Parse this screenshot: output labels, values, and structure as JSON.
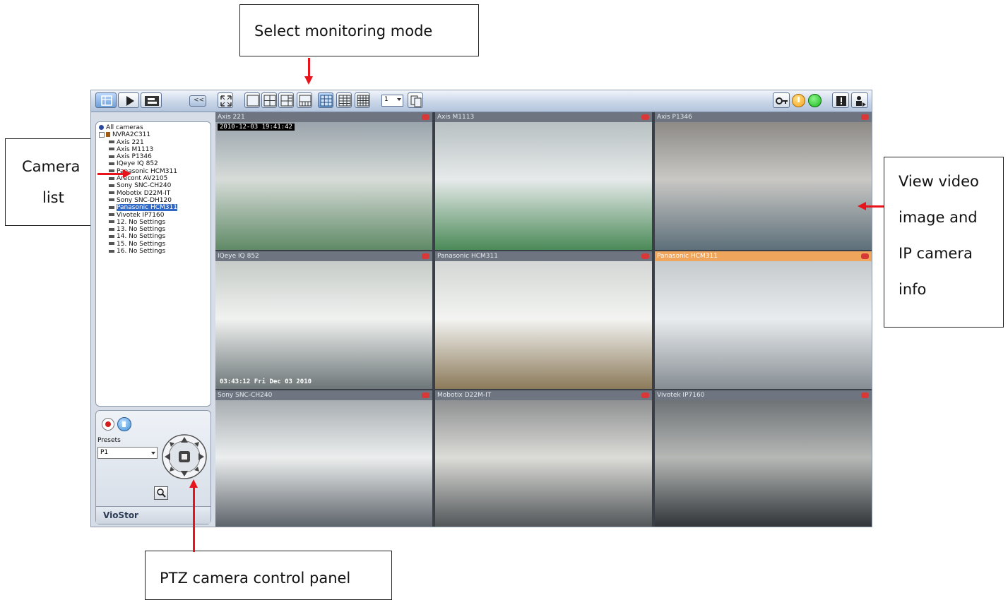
{
  "callouts": {
    "monitoring": "Select monitoring mode",
    "camera_line1": "Camera",
    "camera_line2": "list",
    "view_line1": "View video",
    "view_line2": "image and",
    "view_line3": "IP camera",
    "view_line4": "info",
    "ptz": "PTZ camera control panel"
  },
  "toolbar": {
    "collapse_label": "<<",
    "channel_value": "1"
  },
  "tree": {
    "root": "All cameras",
    "server": "NVRA2C311",
    "cameras": [
      "Axis 221",
      "Axis M1113",
      "Axis P1346",
      "IQeye IQ 852",
      "Panasonic HCM311",
      "Arecont AV2105",
      "Sony SNC-CH240",
      "Mobotix D22M-IT",
      "Sony SNC-DH120",
      "Panasonic HCM311",
      "Vivotek IP7160",
      "12. No Settings",
      "13. No Settings",
      "14. No Settings",
      "15. No Settings",
      "16. No Settings"
    ],
    "selected_index": 9
  },
  "ptz": {
    "presets_label": "Presets",
    "preset_value": "P1",
    "brand": "VioStor"
  },
  "tiles": [
    {
      "name": "Axis 221",
      "overlay": "2010-12-03 19:41:42",
      "selected": false
    },
    {
      "name": "Axis M1113",
      "overlay": "",
      "selected": false
    },
    {
      "name": "Axis P1346",
      "overlay": "",
      "selected": false
    },
    {
      "name": "IQeye IQ 852",
      "overlay": "03:43:12 Fri Dec 03 2010",
      "selected": false
    },
    {
      "name": "Panasonic HCM311",
      "overlay": "",
      "selected": false
    },
    {
      "name": "Panasonic HCM311",
      "overlay": "",
      "selected": true
    },
    {
      "name": "Sony SNC-CH240",
      "overlay": "",
      "selected": false
    },
    {
      "name": "Mobotix D22M-IT",
      "overlay": "",
      "selected": false
    },
    {
      "name": "Vivotek IP7160",
      "overlay": "",
      "selected": false
    }
  ],
  "colors": {
    "arrow": "#e8141c",
    "selected_tile_bar": "#f0a55d",
    "status_green": "#18b818",
    "status_orange": "#f5a21a"
  }
}
